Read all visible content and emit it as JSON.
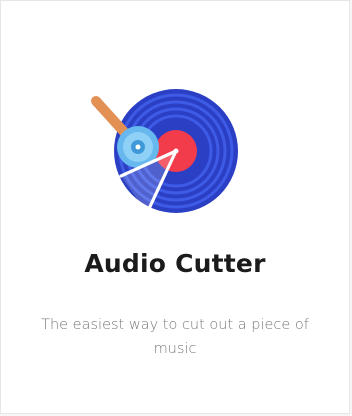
{
  "card": {
    "title": "Audio Cutter",
    "description": "The easiest way to cut out a piece of music",
    "icon": "vinyl-record-cutter-icon"
  },
  "colors": {
    "record_dark": "#2a3fc4",
    "record_light": "#4a67f0",
    "label_red": "#f23b4b",
    "tonearm_base": "#67b8ee",
    "handle": "#e39055"
  }
}
